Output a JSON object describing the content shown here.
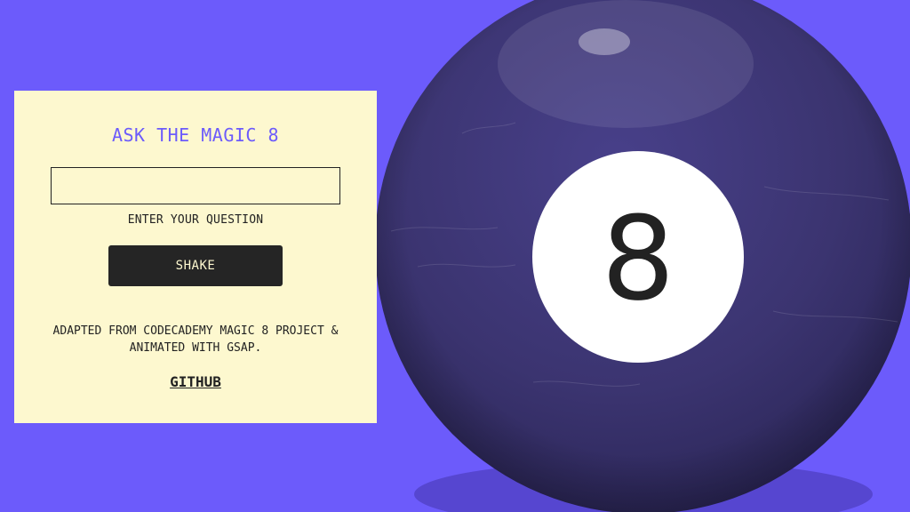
{
  "page": {
    "background_color": "#6c5bfb"
  },
  "panel": {
    "title": "ASK THE MAGIC 8",
    "question_input_value": "",
    "question_input_placeholder": "",
    "input_label": "ENTER YOUR QUESTION",
    "shake_button_label": "SHAKE",
    "credit_line1": "ADAPTED FROM CODECADEMY MAGIC 8 PROJECT &",
    "credit_line2": "ANIMATED WITH GSAP.",
    "github_link_label": "GITHUB"
  },
  "ball": {
    "number": "8",
    "body_color": "#3b3470",
    "window_color": "#ffffff"
  }
}
